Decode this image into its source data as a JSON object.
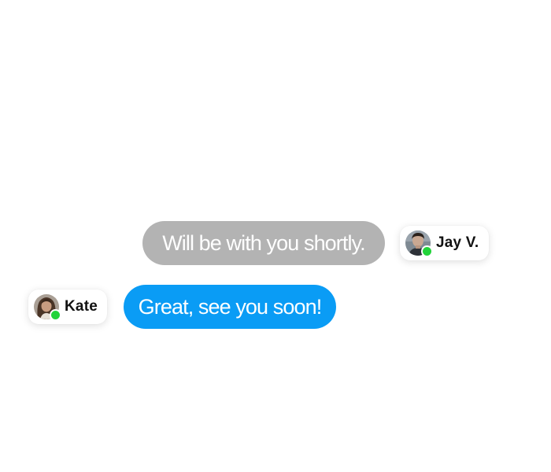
{
  "messages": [
    {
      "text": "Will be with you shortly.",
      "sender": "Jay V.",
      "bubble_color": "#b3b3b3",
      "avatar_icon": "man-portrait-icon",
      "online": true
    },
    {
      "text": "Great, see you soon!",
      "sender": "Kate",
      "bubble_color": "#0a9cf5",
      "avatar_icon": "woman-portrait-icon",
      "online": true
    }
  ],
  "colors": {
    "online_indicator": "#22d33a",
    "background": "#ffffff"
  }
}
